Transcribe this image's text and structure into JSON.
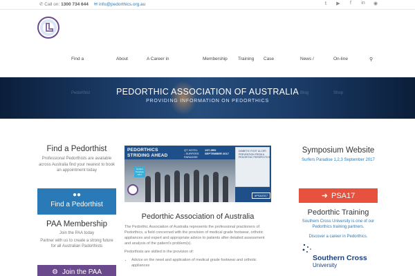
{
  "topbar": {
    "phone_label": "Call on:",
    "phone": "1300 734 644",
    "email": "info@pedorthics.org.au",
    "social_icons": [
      "twitter-icon",
      "youtube-icon",
      "facebook-icon",
      "linkedin-icon",
      "rss-icon"
    ]
  },
  "nav": {
    "items": [
      "Find a",
      "About",
      "A Career in",
      "Membership",
      "Training",
      "Case",
      "News /",
      "On-line"
    ],
    "hidden_second_line": [
      "Pedorthist",
      "Blog",
      "Shop"
    ],
    "search_icon": "search-icon"
  },
  "hero": {
    "title": "PEDORTHIC ASSOCIATION OF AUSTRALIA",
    "subtitle": "PROVIDING INFORMATION ON PEDORTHICS"
  },
  "left": {
    "find_title": "Find a Pedorthist",
    "find_text": "Professional Pedorthists are available across Australia find your nearest to book an appointment today",
    "find_button": "Find a Pedorthist",
    "find_button_icon": "binoculars-icon",
    "member_title": "PAA Membership",
    "member_text1": "Join the PAA today",
    "member_text2": "Partner with us to create a strong future for all Australian Padorthists",
    "member_button": "Join the PAA",
    "member_button_icon": "users-icon"
  },
  "banner": {
    "line1": "PEDORTHICS",
    "line2": "STRIDING AHEAD",
    "venue": "QT HOTEL\n- SURFERS\nPARADISE",
    "dates": "1ST-3RD\nSEPTEMBER 2017",
    "card_text": "DIABETIC FOOT ULCER\nPREVENTION FROM A\nPEDORTHIC PERSPECTIVE",
    "hashtag": "#PSA2017",
    "tag": "Surfers\nParadise\n2017"
  },
  "center": {
    "title": "Pedorthic Association of Australia",
    "para1": "The Pedorthic Association of Australia represents the professional practioners of Pedorthics, a field concerned with the provision of medical grade footwear, orthotic appliances and expert and appropriate advice to patients after detailed assessment and analysis of the patient's problem(s).",
    "para2": "Pedorthists are skilled in the provision of:",
    "bullets": [
      "Advice on the need and application of medical grade footwear and orthotic appliances"
    ]
  },
  "right": {
    "symp_title": "Symposium Website",
    "symp_text": "Surfers Paradise 1,2,3 September 2017",
    "psa_button": "PSA17",
    "psa_button_icon": "arrow-right-icon",
    "training_title": "Pedorthic Training",
    "training_text1": "Southern Cross University is one of our Pedorthics training partners.",
    "training_text2": "Discover a career in Pedorthics.",
    "scu_name1": "Southern Cross",
    "scu_name2": "University"
  },
  "colors": {
    "blue": "#2a7ab8",
    "purple": "#6a4a8c",
    "red": "#e6523d",
    "hero_dark": "#0b1e3a"
  }
}
